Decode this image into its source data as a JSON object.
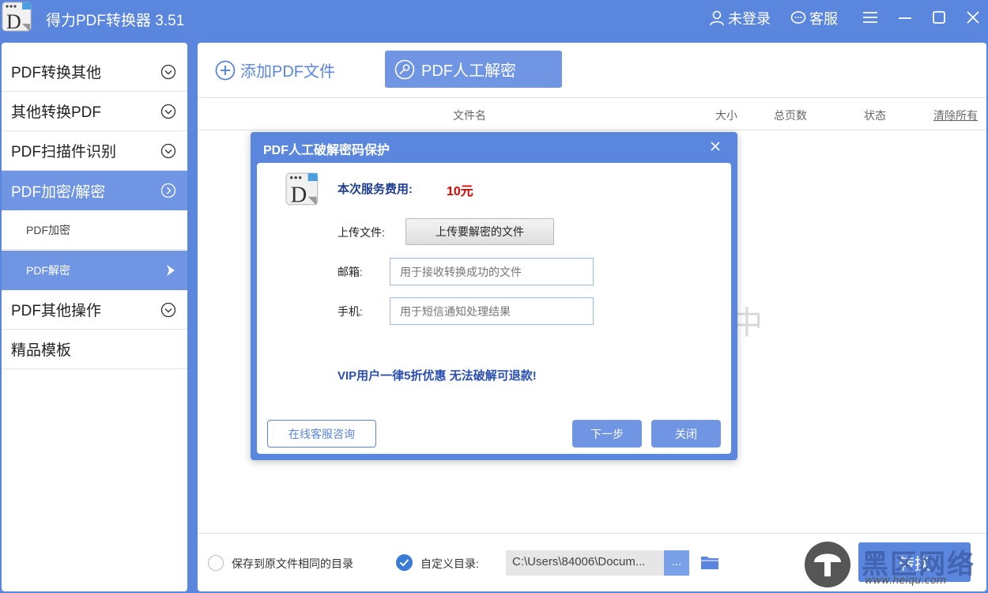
{
  "app": {
    "title": "得力PDF转换器 3.51"
  },
  "titlebar": {
    "login_label": "未登录",
    "service_label": "客服",
    "icons": [
      "user-icon",
      "chat-icon",
      "menu-icon",
      "minimize-icon",
      "maximize-icon",
      "close-icon"
    ]
  },
  "sidebar": {
    "items": [
      {
        "label": "PDF转换其他"
      },
      {
        "label": "其他转换PDF"
      },
      {
        "label": "PDF扫描件识别"
      },
      {
        "label": "PDF加密/解密"
      },
      {
        "label": "PDF其他操作"
      },
      {
        "label": "精品模板"
      }
    ],
    "subitems": [
      {
        "label": "PDF加密"
      },
      {
        "label": "PDF解密"
      }
    ]
  },
  "toolbar": {
    "add_label": "添加PDF文件",
    "decrypt_label": "PDF人工解密"
  },
  "table": {
    "columns": [
      "文件名",
      "大小",
      "总页数",
      "状态"
    ],
    "clear_label": "清除所有"
  },
  "background_text": "中",
  "bottom": {
    "same_dir_label": "保存到原文件相同的目录",
    "custom_dir_label": "自定义目录:",
    "path_value": "C:\\Users\\84006\\Docum...",
    "browse_label": "...",
    "convert_label": "转换"
  },
  "watermark": {
    "text": "黑区网络",
    "url": "www.heiqu.com"
  },
  "dialog": {
    "title": "PDF人工破解密码保护",
    "fee_label": "本次服务费用:",
    "fee_value": "10元",
    "upload_label": "上传文件:",
    "upload_button": "上传要解密的文件",
    "email_label": "邮箱:",
    "email_placeholder": "用于接收转换成功的文件",
    "phone_label": "手机:",
    "phone_placeholder": "用于短信通知处理结果",
    "vip_note": "VIP用户一律5折优惠 无法破解可退款!",
    "consult_button": "在线客服咨询",
    "next_button": "下一步",
    "close_button": "关闭"
  },
  "colors": {
    "accent": "#5b86dd",
    "active": "#6f95e3",
    "fee": "#e00000"
  }
}
